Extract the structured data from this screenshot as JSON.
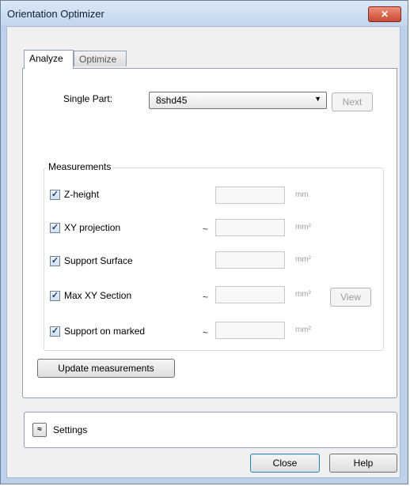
{
  "window": {
    "title": "Orientation Optimizer",
    "close_label": "✕"
  },
  "tabs": [
    {
      "label": "Analyze",
      "active": true
    },
    {
      "label": "Optimize",
      "active": false
    }
  ],
  "analyze": {
    "single_part_label": "Single Part:",
    "single_part_value": "8shd45",
    "next_label": "Next",
    "measurements": {
      "title": "Measurements",
      "rows": [
        {
          "label": "Z-height",
          "checked": true,
          "approx": "",
          "unit": "mm",
          "value": ""
        },
        {
          "label": "XY projection",
          "checked": true,
          "approx": "~",
          "unit": "mm²",
          "value": ""
        },
        {
          "label": "Support Surface",
          "checked": true,
          "approx": "",
          "unit": "mm²",
          "value": ""
        },
        {
          "label": "Max XY Section",
          "checked": true,
          "approx": "~",
          "unit": "mm²",
          "value": "",
          "view_label": "View"
        },
        {
          "label": "Support on marked",
          "checked": true,
          "approx": "~",
          "unit": "mm²",
          "value": ""
        }
      ]
    },
    "update_label": "Update measurements"
  },
  "settings": {
    "label": "Settings",
    "toggle_icon": "double-chevron-down-icon"
  },
  "footer": {
    "close_label": "Close",
    "help_label": "Help"
  },
  "colors": {
    "title_bar": "#c3d6ee",
    "close_button": "#c84a32",
    "default_button_border": "#3c7fb1"
  }
}
